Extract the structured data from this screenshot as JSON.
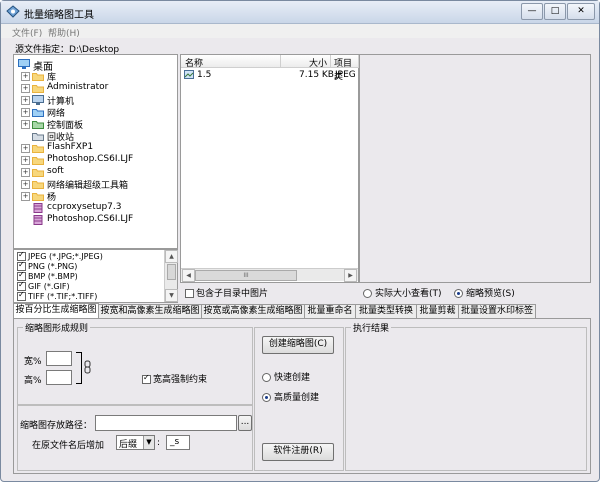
{
  "window": {
    "title": "批量缩略图工具",
    "minimize": "—",
    "restore": "□",
    "close": "✕"
  },
  "menu": [
    "文件(F)",
    "帮助(H)"
  ],
  "source": {
    "label": "源文件指定：",
    "path": "D:\\Desktop"
  },
  "tree": [
    {
      "label": "桌面",
      "icon": "desktop-icon",
      "level": 0,
      "expander": ""
    },
    {
      "label": "库",
      "icon": "folder-icon",
      "level": 1,
      "expander": "+"
    },
    {
      "label": "Administrator",
      "icon": "user-folder-icon",
      "level": 1,
      "expander": "+"
    },
    {
      "label": "计算机",
      "icon": "computer-icon",
      "level": 1,
      "expander": "+"
    },
    {
      "label": "网络",
      "icon": "network-icon",
      "level": 1,
      "expander": "+"
    },
    {
      "label": "控制面板",
      "icon": "control-panel-icon",
      "level": 1,
      "expander": "+"
    },
    {
      "label": "回收站",
      "icon": "recycle-bin-icon",
      "level": 1,
      "expander": ""
    },
    {
      "label": "FlashFXP1",
      "icon": "folder-icon",
      "level": 1,
      "expander": "+"
    },
    {
      "label": "Photoshop.CS6I.LJF",
      "icon": "folder-icon",
      "level": 1,
      "expander": "+"
    },
    {
      "label": "soft",
      "icon": "folder-icon",
      "level": 1,
      "expander": "+"
    },
    {
      "label": "网络编辑超级工具箱",
      "icon": "folder-icon",
      "level": 1,
      "expander": "+"
    },
    {
      "label": "杨",
      "icon": "folder-icon",
      "level": 1,
      "expander": "+"
    },
    {
      "label": "ccproxysetup7.3",
      "icon": "archive-icon",
      "level": 1,
      "expander": ""
    },
    {
      "label": "Photoshop.CS6I.LJF",
      "icon": "archive-icon",
      "level": 1,
      "expander": ""
    }
  ],
  "formats": [
    {
      "label": "JPEG (*.JPG;*.JPEG)",
      "checked": true
    },
    {
      "label": "PNG (*.PNG)",
      "checked": true
    },
    {
      "label": "BMP (*.BMP)",
      "checked": true
    },
    {
      "label": "GIF (*.GIF)",
      "checked": true
    },
    {
      "label": "TIFF (*.TIF;*.TIFF)",
      "checked": true
    }
  ],
  "file_list": {
    "columns": [
      "名称",
      "大小",
      "项目类"
    ],
    "rows": [
      {
        "name": "1.5",
        "size": "7.15 KB",
        "type": "JPEG"
      }
    ],
    "hscroll_label": "III"
  },
  "include_subdirs": "包含子目录中图片",
  "preview_options": {
    "actual_size": "实际大小查看(T)",
    "thumbnail": "缩略预览(S)",
    "selected": "thumbnail"
  },
  "tabs": [
    "按百分比生成缩略图",
    "按宽和高像素生成缩略图",
    "按宽或高像素生成缩略图",
    "批量重命名",
    "批量类型转换",
    "批量剪裁",
    "批量设置水印标签"
  ],
  "rules": {
    "title": "缩略图形成规则",
    "width_label": "宽%",
    "height_label": "高%",
    "lock_label": "宽高强制约束"
  },
  "output": {
    "path_label": "缩略图存放路径：",
    "browse": "...",
    "suffix_label": "在原文件名后增加",
    "suffix_mode": "后缀",
    "suffix_value": "_s"
  },
  "actions": {
    "create": "创建缩略图(C)",
    "fast": "快速创建",
    "quality": "高质量创建",
    "register": "软件注册(R)",
    "selected": "quality"
  },
  "result_title": "执行结果"
}
